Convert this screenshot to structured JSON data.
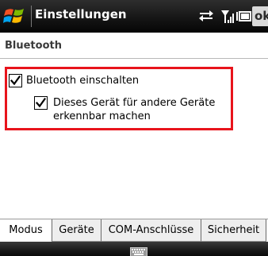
{
  "titlebar": {
    "title": "Einstellungen",
    "ok_label": "ok"
  },
  "page": {
    "title": "Bluetooth"
  },
  "options": {
    "bluetooth_on": {
      "label": "Bluetooth einschalten",
      "checked": true
    },
    "discoverable": {
      "label": "Dieses Gerät für andere Geräte erkennbar machen",
      "checked": true
    }
  },
  "tabs": [
    {
      "label": "Modus",
      "active": true
    },
    {
      "label": "Geräte",
      "active": false
    },
    {
      "label": "COM-Anschlüsse",
      "active": false
    },
    {
      "label": "Sicherheit",
      "active": false
    }
  ],
  "icons": {
    "start": "windows-flag-icon",
    "connectivity": "connectivity-arrows-icon",
    "signal": "signal-strength-icon",
    "battery": "battery-icon",
    "keyboard": "keyboard-icon"
  },
  "colors": {
    "highlight": "#e8141c",
    "titlebar": "#161616"
  }
}
